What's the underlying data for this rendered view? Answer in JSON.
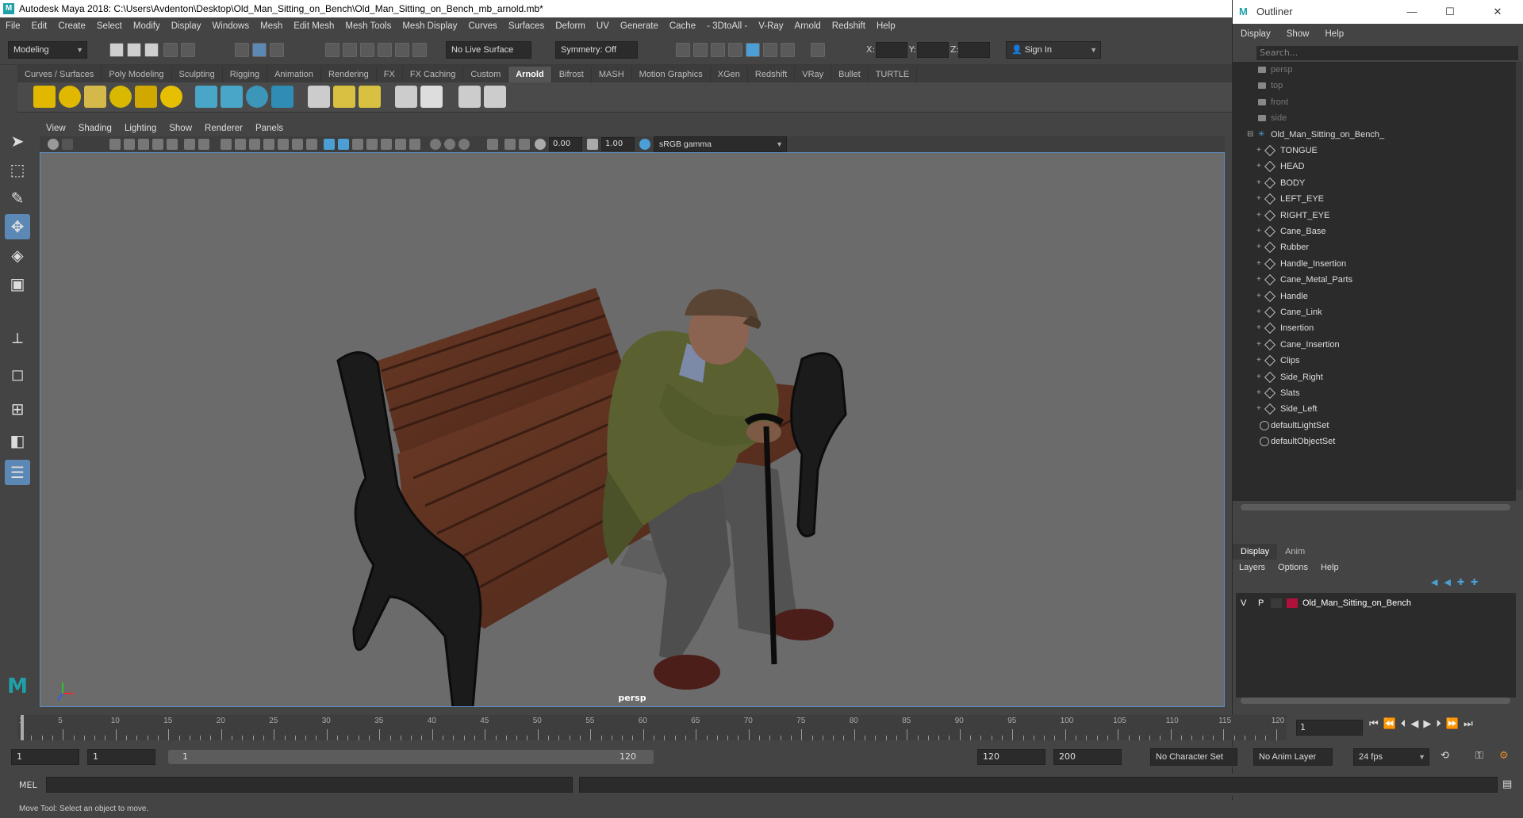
{
  "window": {
    "title": "Autodesk Maya 2018: C:\\Users\\Avdenton\\Desktop\\Old_Man_Sitting_on_Bench\\Old_Man_Sitting_on_Bench_mb_arnold.mb*"
  },
  "menubar": [
    "File",
    "Edit",
    "Create",
    "Select",
    "Modify",
    "Display",
    "Windows",
    "Mesh",
    "Edit Mesh",
    "Mesh Tools",
    "Mesh Display",
    "Curves",
    "Surfaces",
    "Deform",
    "UV",
    "Generate",
    "Cache",
    "- 3DtoAll -",
    "V-Ray",
    "Arnold",
    "Redshift",
    "Help"
  ],
  "statusline": {
    "menuset": "Modeling",
    "live_surface": "No Live Surface",
    "symmetry": "Symmetry: Off",
    "x_label": "X:",
    "y_label": "Y:",
    "z_label": "Z:",
    "sign_in": "Sign In"
  },
  "shelf_tabs": [
    "Curves / Surfaces",
    "Poly Modeling",
    "Sculpting",
    "Rigging",
    "Animation",
    "Rendering",
    "FX",
    "FX Caching",
    "Custom",
    "Arnold",
    "Bifrost",
    "MASH",
    "Motion Graphics",
    "XGen",
    "Redshift",
    "VRay",
    "Bullet",
    "TURTLE"
  ],
  "shelf_active": "Arnold",
  "viewport": {
    "menus": [
      "View",
      "Shading",
      "Lighting",
      "Show",
      "Renderer",
      "Panels"
    ],
    "exposure": "0.00",
    "gamma": "1.00",
    "color_space": "sRGB gamma",
    "camera_label": "persp"
  },
  "outliner": {
    "title": "Outliner",
    "menus": [
      "Display",
      "Show",
      "Help"
    ],
    "search_placeholder": "Search...",
    "cameras": [
      "persp",
      "top",
      "front",
      "side"
    ],
    "group": "Old_Man_Sitting_on_Bench_",
    "children": [
      "TONGUE",
      "HEAD",
      "BODY",
      "LEFT_EYE",
      "RIGHT_EYE",
      "Cane_Base",
      "Rubber",
      "Handle_Insertion",
      "Cane_Metal_Parts",
      "Handle",
      "Cane_Link",
      "Insertion",
      "Cane_Insertion",
      "Clips",
      "Side_Right",
      "Slats",
      "Side_Left"
    ],
    "sets": [
      "defaultLightSet",
      "defaultObjectSet"
    ]
  },
  "layer_editor": {
    "tabs": [
      "Display",
      "Anim"
    ],
    "active_tab": "Display",
    "menus": [
      "Layers",
      "Options",
      "Help"
    ],
    "layers": [
      {
        "v": "V",
        "p": "P",
        "name": "Old_Man_Sitting_on_Bench",
        "color": "#b0103a"
      }
    ]
  },
  "timeline": {
    "ticks": [
      5,
      10,
      15,
      20,
      25,
      30,
      35,
      40,
      45,
      50,
      55,
      60,
      65,
      70,
      75,
      80,
      85,
      90,
      95,
      100,
      105,
      110,
      115,
      120
    ],
    "first_tick": "1",
    "current_frame": "1"
  },
  "range": {
    "start": "1",
    "playback_start": "1",
    "slider_start": "1",
    "slider_end": "120",
    "playback_end": "120",
    "end": "200",
    "character_set": "No Character Set",
    "anim_layer": "No Anim Layer",
    "fps": "24 fps"
  },
  "cmdline": {
    "label": "MEL"
  },
  "helpline": {
    "text": "Move Tool: Select an object to move."
  }
}
